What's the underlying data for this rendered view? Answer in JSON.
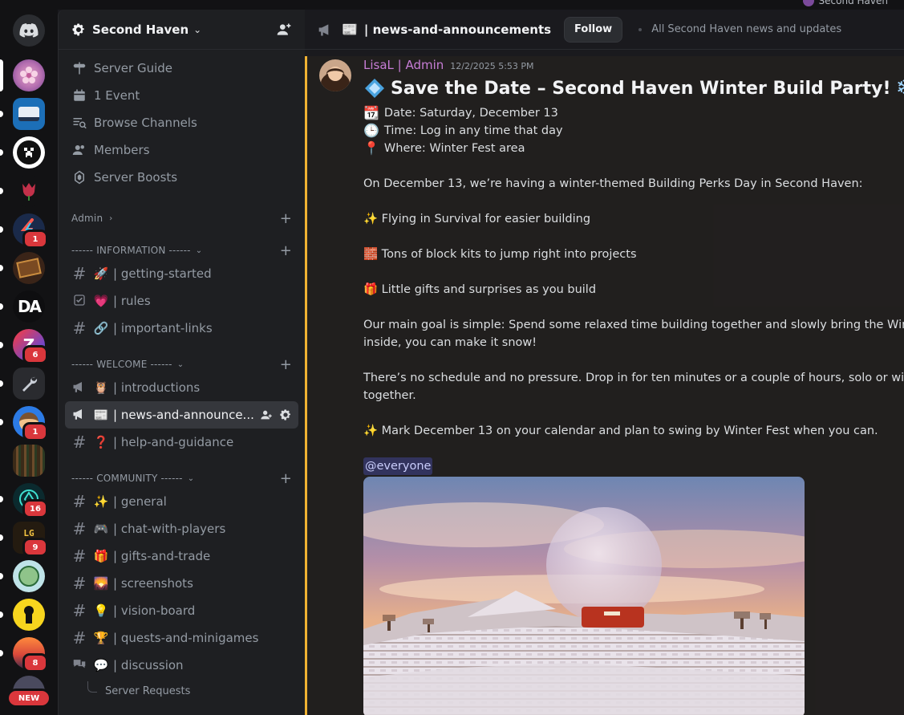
{
  "top": {
    "server_name": "Second Haven"
  },
  "rail": {
    "badges": {
      "s5": "1",
      "s8": "6",
      "s10": "1",
      "s12": "16",
      "s13": "9",
      "s17": "8"
    },
    "new_label": "NEW",
    "lg_text": "LG 5",
    "da_text": "DA"
  },
  "sidebar": {
    "server_title": "Second Haven",
    "nav": [
      "Server Guide",
      "1 Event",
      "Browse Channels",
      "Members",
      "Server Boosts"
    ],
    "admin_label": "Admin",
    "categories": {
      "information": "------ INFORMATION ------",
      "welcome": "------ WELCOME ------",
      "community": "------ COMMUNITY ------"
    },
    "channels": {
      "getting_started": "| getting-started",
      "rules": "| rules",
      "important_links": "| important-links",
      "introductions": "| introductions",
      "news": "| news-and-announce...",
      "help": "| help-and-guidance",
      "general": "| general",
      "chat": "| chat-with-players",
      "gifts": "| gifts-and-trade",
      "screenshots": "| screenshots",
      "vision": "| vision-board",
      "quests": "| quests-and-minigames",
      "discussion": "| discussion"
    },
    "emojis": {
      "getting_started": "🚀",
      "rules": "💗",
      "important_links": "🔗",
      "introductions": "🦉",
      "news": "📰",
      "help": "❓",
      "general": "✨",
      "chat": "🎮",
      "gifts": "🎁",
      "screenshots": "🌄",
      "vision": "💡",
      "quests": "🏆",
      "discussion": "💬"
    },
    "thread": "Server Requests"
  },
  "header": {
    "channel": "| news-and-announcements",
    "follow": "Follow",
    "topic": "All Second Haven news and updates"
  },
  "message": {
    "author": "LisaL | Admin",
    "timestamp": "12/2/2025 5:53 PM",
    "title": "Save the Date – Second Haven Winter Build Party!",
    "date": "Date: Saturday, December 13",
    "time": "Time: Log in any time that day",
    "where": "Where: Winter Fest area",
    "p1": "On December 13, we’re having a winter-themed Building Perks Day in Second Haven:",
    "b1": "Flying in Survival for easier building",
    "b2": "Tons of block kits to jump right into projects",
    "b3": "Little gifts and surprises as you build",
    "p2a": "Our main goal is simple: Spend some relaxed time building together and slowly bring the Winter Fest",
    "p2b": "inside, you can make it snow!",
    "p3a": "There’s no schedule and no pressure. Drop in for ten minutes or a couple of hours, solo or with other",
    "p3b": "together.",
    "p4": "Mark December 13 on your calendar and plan to swing by Winter Fest when you can.",
    "mention": "@everyone"
  },
  "colors": {
    "mention_bar": "#f0b232",
    "author": "#c77dd6",
    "badge": "#da373c"
  }
}
